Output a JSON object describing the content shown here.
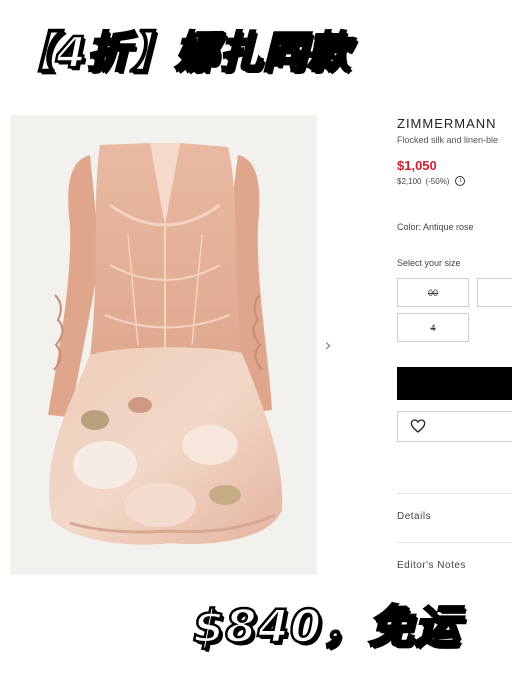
{
  "banner": {
    "title": "【4折】娜扎同款"
  },
  "product": {
    "brand": "ZIMMERMANN",
    "subtitle": "Flocked silk and linen-ble",
    "price": "$1,050",
    "original_price": "$2,100",
    "discount": "(-50%)",
    "color_label": "Color:",
    "color_value": "Antique rose",
    "size_prompt": "Select your size",
    "sizes": [
      {
        "label": "00",
        "available": false
      },
      {
        "label": "",
        "available": true
      },
      {
        "label": "4",
        "available": false
      }
    ],
    "accordion": [
      "Details",
      "Editor's Notes"
    ]
  },
  "promo": {
    "text": "$840，免运"
  },
  "icons": {
    "next": "chevron-right-icon",
    "info": "info-icon",
    "wishlist": "heart-outline-icon"
  },
  "colors": {
    "price_red": "#d11f2f",
    "button_black": "#000000",
    "dress_pink": "#e8b8a3"
  }
}
